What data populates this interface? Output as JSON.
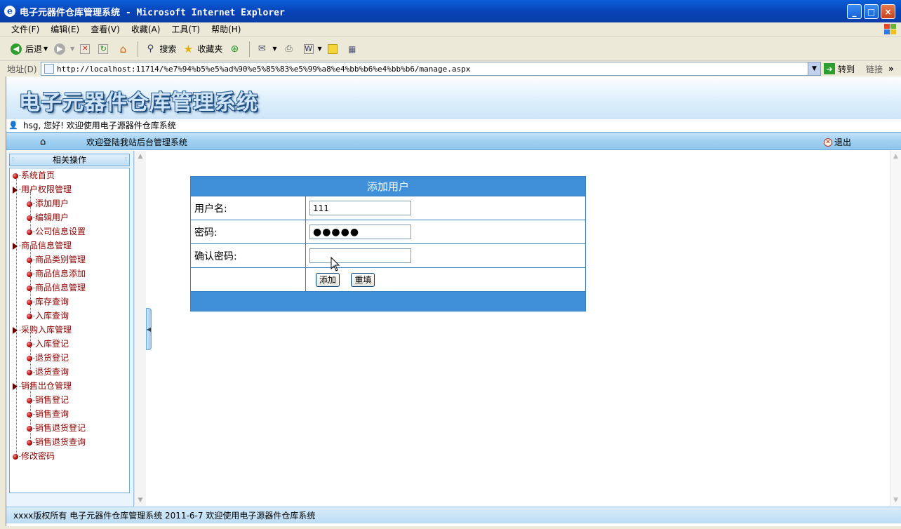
{
  "window": {
    "title": "电子元器件仓库管理系统 - Microsoft Internet Explorer",
    "buttons": {
      "minimize": "_",
      "maximize": "□",
      "close": "×"
    }
  },
  "menu": [
    "文件(F)",
    "编辑(E)",
    "查看(V)",
    "收藏(A)",
    "工具(T)",
    "帮助(H)"
  ],
  "toolbar": {
    "back": "后退",
    "search": "搜索",
    "favorites": "收藏夹"
  },
  "address": {
    "label": "地址(D)",
    "url": "http://localhost:11714/%e7%94%b5%e5%ad%90%e5%85%83%e5%99%a8%e4%bb%b6%e4%bb%b6/manage.aspx",
    "go": "转到",
    "links": "链接",
    "more": "»"
  },
  "site": {
    "system_name": "电子元器件仓库管理系统",
    "welcome_user": "hsg, 您好! 欢迎使用电子源器件仓库系统",
    "nav_text": "欢迎登陆我站后台管理系统",
    "logout": "退出"
  },
  "sidebar": {
    "header": "相关操作",
    "items": [
      {
        "label": "系统首页",
        "level": 0,
        "type": "leaf"
      },
      {
        "label": "用户权限管理",
        "level": 0,
        "type": "group"
      },
      {
        "label": "添加用户",
        "level": 1,
        "type": "leaf"
      },
      {
        "label": "编辑用户",
        "level": 1,
        "type": "leaf"
      },
      {
        "label": "公司信息设置",
        "level": 1,
        "type": "leaf"
      },
      {
        "label": "商品信息管理",
        "level": 0,
        "type": "group"
      },
      {
        "label": "商品类别管理",
        "level": 1,
        "type": "leaf"
      },
      {
        "label": "商品信息添加",
        "level": 1,
        "type": "leaf"
      },
      {
        "label": "商品信息管理",
        "level": 1,
        "type": "leaf"
      },
      {
        "label": "库存查询",
        "level": 1,
        "type": "leaf"
      },
      {
        "label": "入库查询",
        "level": 1,
        "type": "leaf"
      },
      {
        "label": "采购入库管理",
        "level": 0,
        "type": "group"
      },
      {
        "label": "入库登记",
        "level": 1,
        "type": "leaf"
      },
      {
        "label": "退货登记",
        "level": 1,
        "type": "leaf"
      },
      {
        "label": "退货查询",
        "level": 1,
        "type": "leaf"
      },
      {
        "label": "销售出仓管理",
        "level": 0,
        "type": "group"
      },
      {
        "label": "销售登记",
        "level": 1,
        "type": "leaf"
      },
      {
        "label": "销售查询",
        "level": 1,
        "type": "leaf"
      },
      {
        "label": "销售退货登记",
        "level": 1,
        "type": "leaf"
      },
      {
        "label": "销售退货查询",
        "level": 1,
        "type": "leaf"
      },
      {
        "label": "修改密码",
        "level": 0,
        "type": "leaf"
      }
    ]
  },
  "form": {
    "title": "添加用户",
    "username_label": "用户名:",
    "username_value": "111",
    "password_label": "密码:",
    "password_value": "●●●●●",
    "confirm_label": "确认密码:",
    "confirm_value": "",
    "add_button": "添加",
    "reset_button": "重填"
  },
  "footer": {
    "text": "xxxx版权所有  电子元器件仓库管理系统  2011-6-7  欢迎使用电子源器件仓库系统"
  },
  "colors": {
    "title_bar": "#0842b5",
    "form_header": "#3f8fd9",
    "tree_text": "#8b0000",
    "nav_bar": "#9fd0f1"
  }
}
